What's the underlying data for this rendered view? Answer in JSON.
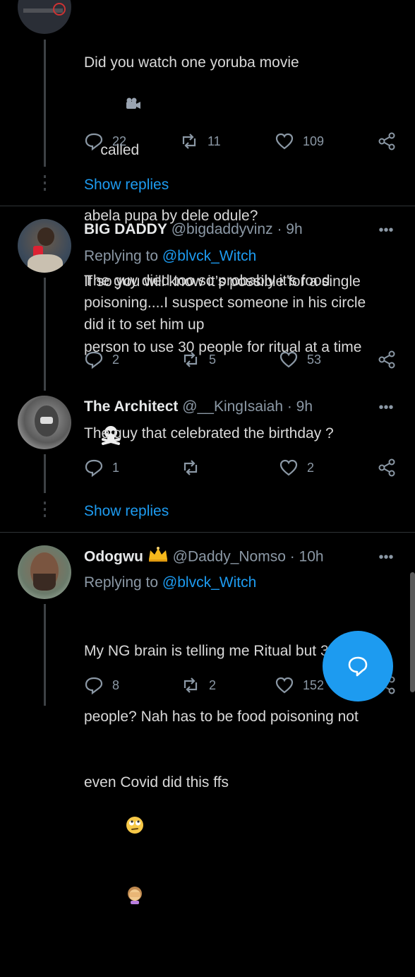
{
  "tweets": [
    {
      "text_lines": [
        "Did you watch one yoruba movie",
        "called",
        "abela pupa by dele odule?",
        "If so you will know it’s possible for a single",
        "person to use 30 people for ritual at a time"
      ],
      "camera_icon": "movie-camera-icon",
      "skull_icon": "skull-crossbones-icon",
      "replies": "22",
      "retweets": "11",
      "likes": "109"
    },
    {
      "name": "BIG DADDY",
      "handle": "@bigdaddyvinz",
      "time": "· 9h",
      "replying_prefix": "Replying to ",
      "replying_to": "@blvck_Witch",
      "text": "The guy died too so probably it's food\npoisoning....I suspect someone in his circle\ndid it to set him up",
      "replies": "2",
      "retweets": "5",
      "likes": "53"
    },
    {
      "name": "The Architect",
      "handle": "@__KingIsaiah",
      "time": "· 9h",
      "text": "The guy that celebrated the birthday ?",
      "replies": "1",
      "retweets": "",
      "likes": "2"
    },
    {
      "name": "Odogwu",
      "handle": "@Daddy_Nomso",
      "time": "· 10h",
      "replying_prefix": "Replying to ",
      "replying_to": "@blvck_Witch",
      "text_line1": "My NG brain is telling me Ritual but 30",
      "text_line2": "people? Nah has to be food poisoning not",
      "text_line3": "even Covid did this ffs",
      "replies": "8",
      "retweets": "2",
      "likes": "152"
    }
  ],
  "show_replies": "Show replies",
  "more": "•••",
  "colors": {
    "accent": "#1d9bf0",
    "muted": "#8b98a5",
    "background": "#000000"
  }
}
